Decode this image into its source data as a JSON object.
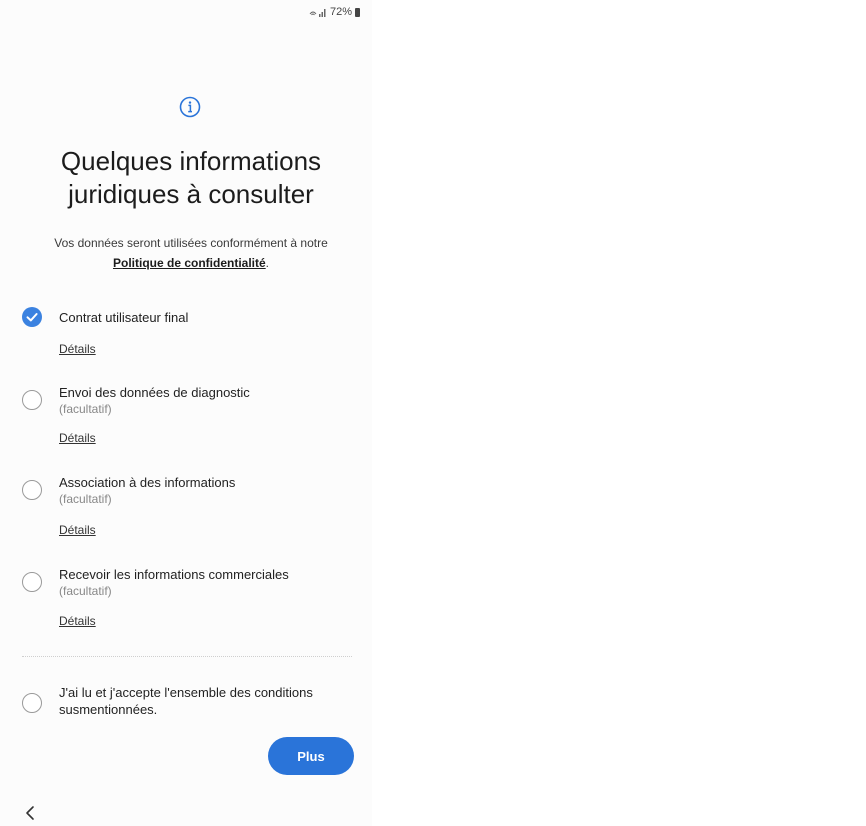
{
  "status_bar": {
    "text": "72%",
    "icons": [
      "wifi-icon",
      "signal-icon",
      "battery-icon"
    ]
  },
  "header": {
    "icon": "info-icon",
    "title_line1": "Quelques informations",
    "title_line2": "juridiques à consulter"
  },
  "intro": {
    "text_before": "Vos données seront utilisées conformément à notre ",
    "link": "Politique de confidentialité",
    "text_after": "."
  },
  "items": [
    {
      "label": "Contrat utilisateur final",
      "sub": "",
      "checked": true,
      "details": "Détails"
    },
    {
      "label": "Envoi des données de diagnostic",
      "sub": "(facultatif)",
      "checked": false,
      "details": "Détails"
    },
    {
      "label": "Association à des informations",
      "sub": "(facultatif)",
      "checked": false,
      "details": "Détails"
    },
    {
      "label": "Recevoir les informations commerciales",
      "sub": "(facultatif)",
      "checked": false,
      "details": "Détails"
    }
  ],
  "accept_all": {
    "label": "J'ai lu et j'accepte l'ensemble des conditions susmentionnées.",
    "checked": false
  },
  "footer": {
    "next_label": "Plus",
    "back_icon": "chevron-left-icon"
  },
  "colors": {
    "accent": "#2a74d9",
    "checked": "#3b82e0"
  }
}
